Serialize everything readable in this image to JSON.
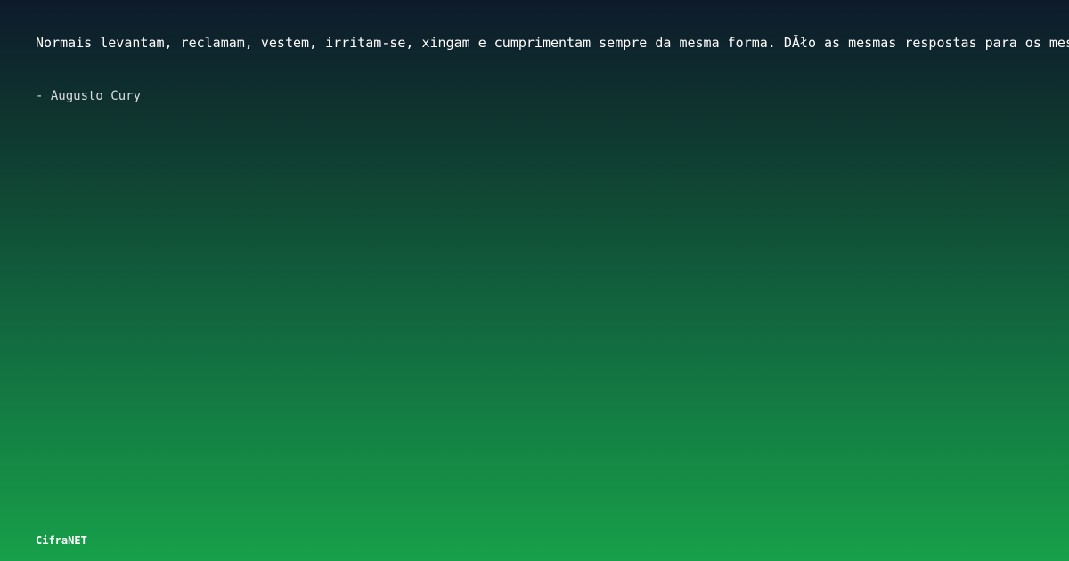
{
  "quote": {
    "text": "Normais levantam, reclamam, vestem, irritam-se, xingam e cumprimentam sempre da mesma forma. DĂło as mesmas respostas para os mesmos problemas."
  },
  "author": {
    "text": "- Augusto Cury"
  },
  "brand": {
    "name": "CifraNET"
  },
  "colors": {
    "gradient_top": "#0e1a2b",
    "gradient_bottom": "#17a049",
    "text": "#ffffff"
  }
}
